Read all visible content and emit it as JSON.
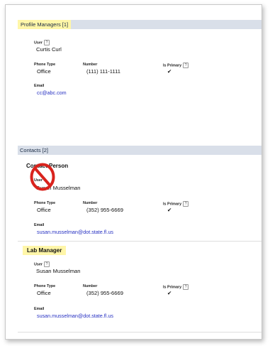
{
  "profile_managers": {
    "header": "Profile Managers [1]",
    "user_label": "User",
    "user_help": "?",
    "user_value": "Curtis Curl",
    "phone_type_label": "Phone Type",
    "phone_type_value": "Office",
    "number_label": "Number",
    "number_value": "(111) 111-1111",
    "is_primary_label": "Is Primary",
    "is_primary_help": "?",
    "is_primary_value": "✔",
    "email_label": "Email",
    "email_value": "cc@abc.com"
  },
  "contacts": {
    "header": "Contacts [2]",
    "contact_person": {
      "title": "Contact Person",
      "user_label": "User",
      "user_value": "Susan Musselman",
      "phone_type_label": "Phone Type",
      "phone_type_value": "Office",
      "number_label": "Number",
      "number_value": "(352) 955-6669",
      "is_primary_label": "Is Primary",
      "is_primary_help": "?",
      "is_primary_value": "✔",
      "email_label": "Email",
      "email_value": "susan.musselman@dot.state.fl.us"
    },
    "lab_manager": {
      "title": "Lab Manager",
      "user_label": "User",
      "user_help": "?",
      "user_value": "Susan Musselman",
      "phone_type_label": "Phone Type",
      "phone_type_value": "Office",
      "number_label": "Number",
      "number_value": "(352) 955-6669",
      "is_primary_label": "Is Primary",
      "is_primary_help": "?",
      "is_primary_value": "✔",
      "email_label": "Email",
      "email_value": "susan.musselman@dot.state.fl.us"
    }
  },
  "colors": {
    "header_bg": "#d9dfe9",
    "highlight": "#fff6a8",
    "link": "#2630c2",
    "prohibition": "#d9231d"
  },
  "icons": {
    "help": "question-mark",
    "primary_check": "check-mark",
    "annotation": "prohibition-sign"
  }
}
